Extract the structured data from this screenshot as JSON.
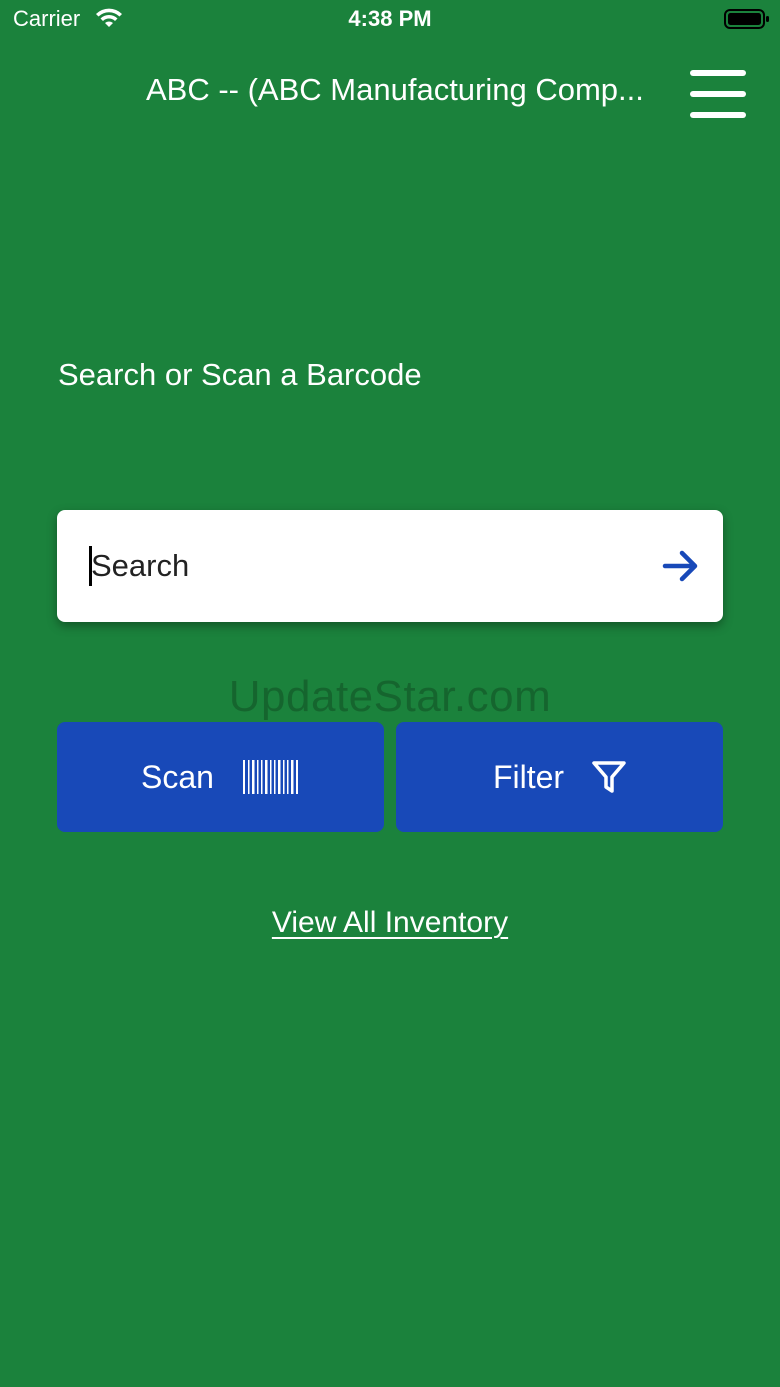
{
  "status_bar": {
    "carrier": "Carrier",
    "time": "4:38 PM",
    "icons": [
      "wifi-icon",
      "battery-icon"
    ]
  },
  "header": {
    "title": "ABC -- (ABC Manufacturing Comp...",
    "menu_icon": "hamburger-menu-icon"
  },
  "main": {
    "prompt": "Search or Scan a Barcode",
    "search": {
      "placeholder": "Search",
      "value": "",
      "submit_icon": "arrow-right-icon"
    },
    "watermark": "UpdateStar.com",
    "scan_button": {
      "label": "Scan",
      "icon": "barcode-icon"
    },
    "filter_button": {
      "label": "Filter",
      "icon": "filter-icon"
    },
    "view_all_link": "View All Inventory"
  },
  "colors": {
    "background": "#1b823c",
    "button": "#1849b8",
    "search_box": "#ffffff",
    "arrow": "#1849b8",
    "text": "#ffffff"
  }
}
